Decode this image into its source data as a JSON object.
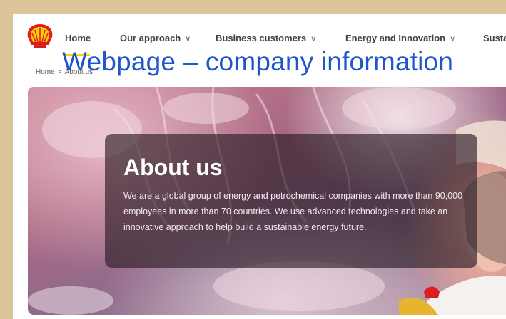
{
  "navigation": {
    "logo_icon": "shell-pecten-icon",
    "items": [
      {
        "label": "Home",
        "has_dropdown": false,
        "active": true
      },
      {
        "label": "Our approach",
        "has_dropdown": true
      },
      {
        "label": "Business customers",
        "has_dropdown": true
      },
      {
        "label": "Energy and Innovation",
        "has_dropdown": true
      },
      {
        "label": "Susta",
        "has_dropdown": false
      }
    ],
    "chevron": "∨"
  },
  "breadcrumb": {
    "home": "Home",
    "separator": ">",
    "current": "About us"
  },
  "overlay_title": "Webpage – company information",
  "hero": {
    "heading": "About us",
    "body": "We are a global group of energy and petrochemical companies with more than 90,000 employees in more than 70 countries. We use advanced technologies and take an innovative approach to help build a sustainable energy future."
  },
  "colors": {
    "brand_red": "#dd1d21",
    "brand_yellow": "#fbce07",
    "overlay_blue": "#1f56c9",
    "frame": "#ddc59a"
  }
}
